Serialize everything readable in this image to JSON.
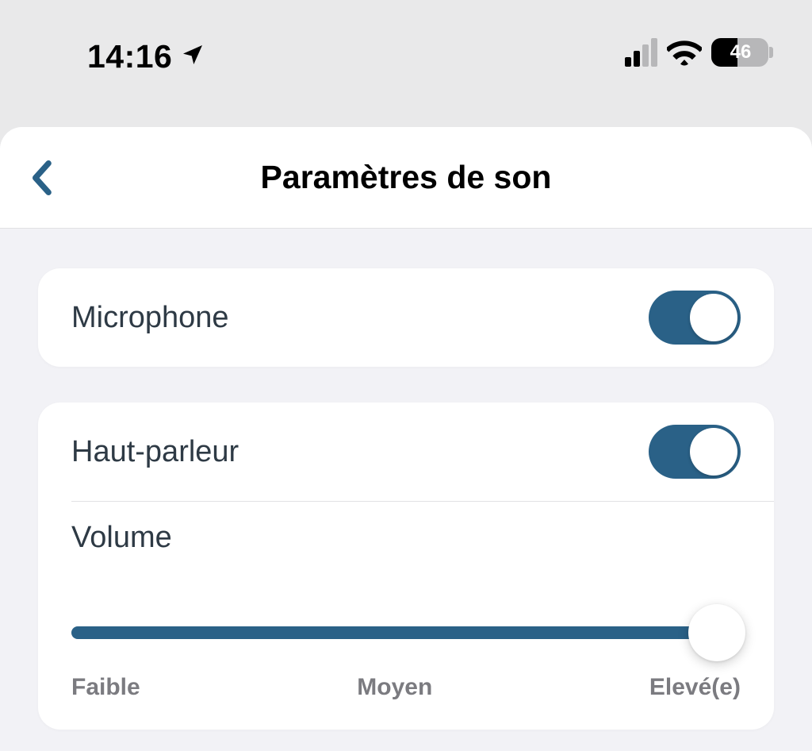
{
  "status": {
    "time": "14:16",
    "battery_percent": "46"
  },
  "header": {
    "title": "Paramètres de son"
  },
  "settings": {
    "microphone": {
      "label": "Microphone",
      "enabled": true
    },
    "speaker": {
      "label": "Haut-parleur",
      "enabled": true
    },
    "volume": {
      "label": "Volume",
      "value_percent": 97,
      "marks": {
        "low": "Faible",
        "mid": "Moyen",
        "high": "Elevé(e)"
      }
    }
  },
  "colors": {
    "accent": "#2a6187"
  }
}
